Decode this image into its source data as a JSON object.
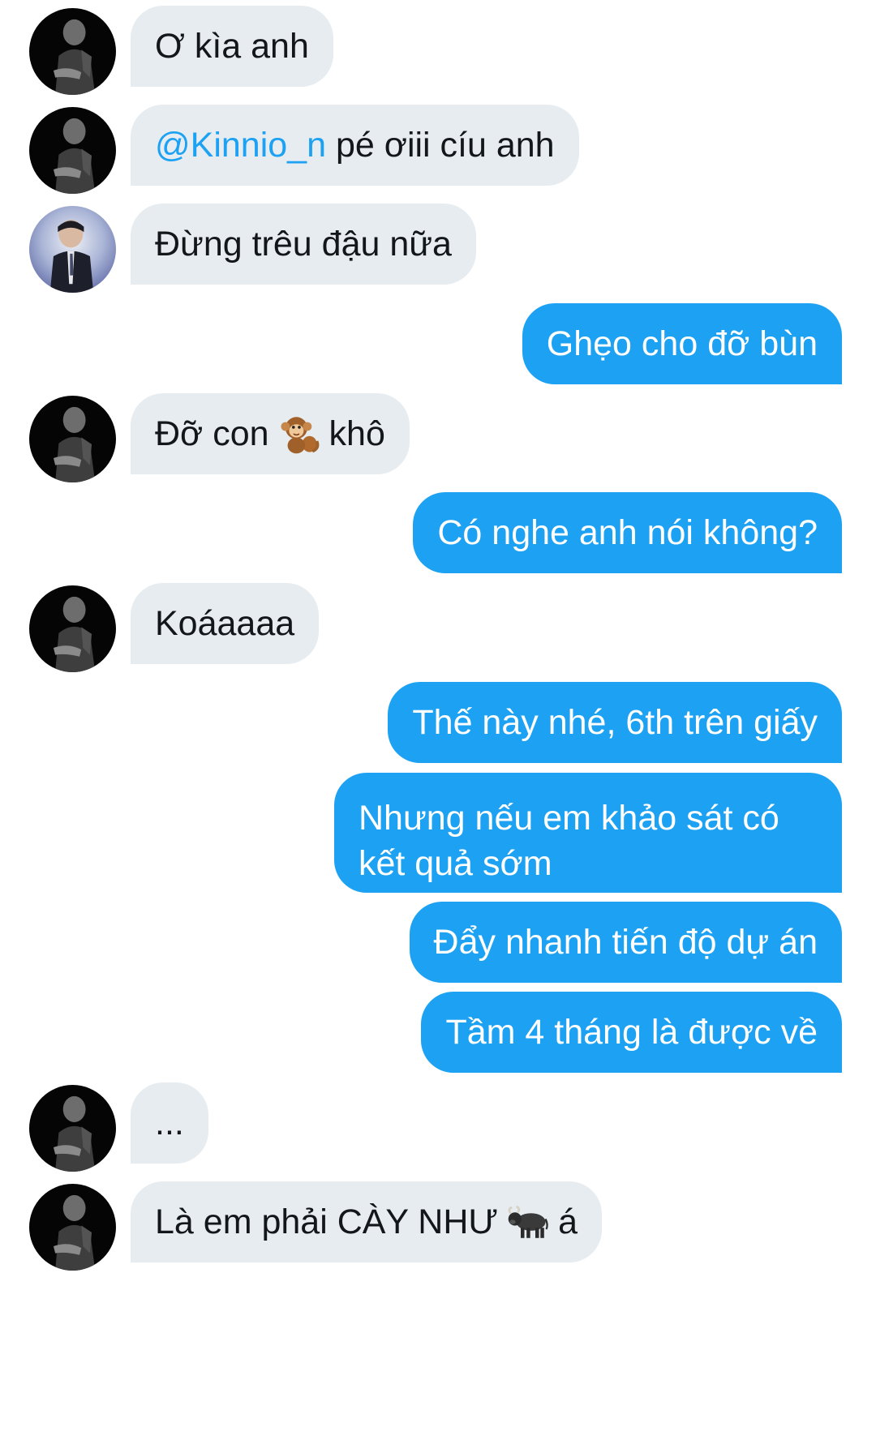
{
  "messages": [
    {
      "side": "in",
      "avatar": "dark",
      "text": "Ơ kìa anh"
    },
    {
      "side": "in",
      "avatar": "dark",
      "mention": "@Kinnio_n",
      "text": "pé ơiii cíu anh"
    },
    {
      "side": "in",
      "avatar": "suit",
      "text": "Đừng trêu đậu nữa"
    },
    {
      "side": "out",
      "text": "Ghẹo cho đỡ bùn"
    },
    {
      "side": "in",
      "avatar": "dark",
      "text_before": "Đỡ con",
      "emoji": "monkey-emoji",
      "text_after": "khô"
    },
    {
      "side": "out",
      "text": "Có nghe anh nói không?"
    },
    {
      "side": "in",
      "avatar": "dark",
      "text": "Koáaaaa"
    },
    {
      "side": "out",
      "text": "Thế này nhé, 6th trên giấy"
    },
    {
      "side": "out",
      "text": "Nhưng nếu em khảo sát có kết quả sớm"
    },
    {
      "side": "out",
      "text": "Đẩy nhanh tiến độ dự án"
    },
    {
      "side": "out",
      "text": "Tầm 4 tháng là được về"
    },
    {
      "side": "in",
      "avatar": "dark",
      "text": "..."
    },
    {
      "side": "in",
      "avatar": "dark",
      "text_before": "Là em phải CÀY NHƯ",
      "emoji": "ox-emoji",
      "text_after": "á"
    }
  ],
  "colors": {
    "incoming_bubble": "#e6ecf0",
    "outgoing_bubble": "#1da1f2",
    "mention": "#1da1f2",
    "incoming_text": "#14171a",
    "outgoing_text": "#ffffff"
  }
}
